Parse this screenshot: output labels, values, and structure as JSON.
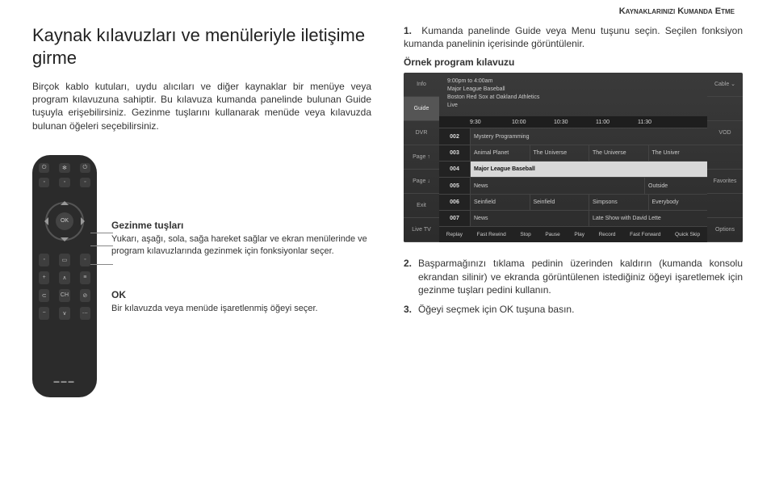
{
  "header": {
    "section_title": "Kaynaklarınızı Kumanda Etme"
  },
  "left": {
    "title": "Kaynak kılavuzları ve menüleriyle iletişime girme",
    "para1": "Birçok kablo kutuları, uydu alıcıları ve diğer kaynaklar bir menüye veya program kılavuzuna sahiptir. Bu kılavuza kumanda panelinde bulunan Guide tuşuyla erişebilirsiniz. Gezinme tuşlarını kullanarak menüde veya kılavuzda bulunan öğeleri seçebilirsiniz."
  },
  "right": {
    "step1_num": "1.",
    "step1_text": "Kumanda panelinde Guide veya Menu tuşunu seçin. Seçilen fonksiyon kumanda panelinin içerisinde görüntülenir.",
    "sample_label": "Örnek program kılavuzu",
    "step2_num": "2.",
    "step2_text": "Başparmağınızı tıklama pedinin üzerinden kaldırın (kumanda konsolu ekrandan silinir) ve ekranda görüntülenen istediğiniz öğeyi işaretlemek için gezinme tuşları pedini kullanın.",
    "step3_num": "3.",
    "step3_text": "Öğeyi seçmek için OK tuşuna basın."
  },
  "remote": {
    "nav_title": "Gezinme tuşları",
    "nav_desc": "Yukarı, aşağı, sola, sağa hareket sağlar ve ekran menülerinde ve program kılavuzlarında gezinmek için fonksiyonlar seçer.",
    "ok_title": "OK",
    "ok_desc": "Bir kılavuzda veya menüde işaretlenmiş öğeyi seçer.",
    "ok_label": "OK"
  },
  "guide": {
    "left_menu": [
      "Info",
      "Guide",
      "DVR",
      "Page ↑",
      "Page ↓",
      "Exit",
      "Live TV"
    ],
    "right_menu": [
      "Cable ⌄",
      "",
      "VOD",
      "",
      "Favorites",
      "",
      "Options"
    ],
    "top_lines": [
      "9:00pm to 4:00am",
      "Major League Baseball",
      "Boston Red Sox at Oakland Athletics",
      "Live"
    ],
    "times": [
      "9:30",
      "10:00",
      "10:30",
      "11:00",
      "11:30"
    ],
    "rows": [
      {
        "ch": "002",
        "cells": [
          "Mystery Programming",
          "",
          "",
          ""
        ]
      },
      {
        "ch": "003",
        "cells": [
          "Animal Planet",
          "The Universe",
          "The Universe",
          "The Univer"
        ]
      },
      {
        "ch": "004",
        "cells": [
          "Major League Baseball",
          "",
          "",
          ""
        ],
        "highlight": true
      },
      {
        "ch": "005",
        "cells": [
          "News",
          "",
          "",
          "Outside"
        ]
      },
      {
        "ch": "006",
        "cells": [
          "Seinfield",
          "Seinfield",
          "Simpsons",
          "Everybody"
        ]
      },
      {
        "ch": "007",
        "cells": [
          "News",
          "",
          "Late Show with David Lette",
          ""
        ]
      }
    ],
    "footer": [
      "Replay",
      "Fast Rewind",
      "Stop",
      "Pause",
      "Play",
      "Record",
      "Fast Forward",
      "Quick Skip"
    ]
  }
}
